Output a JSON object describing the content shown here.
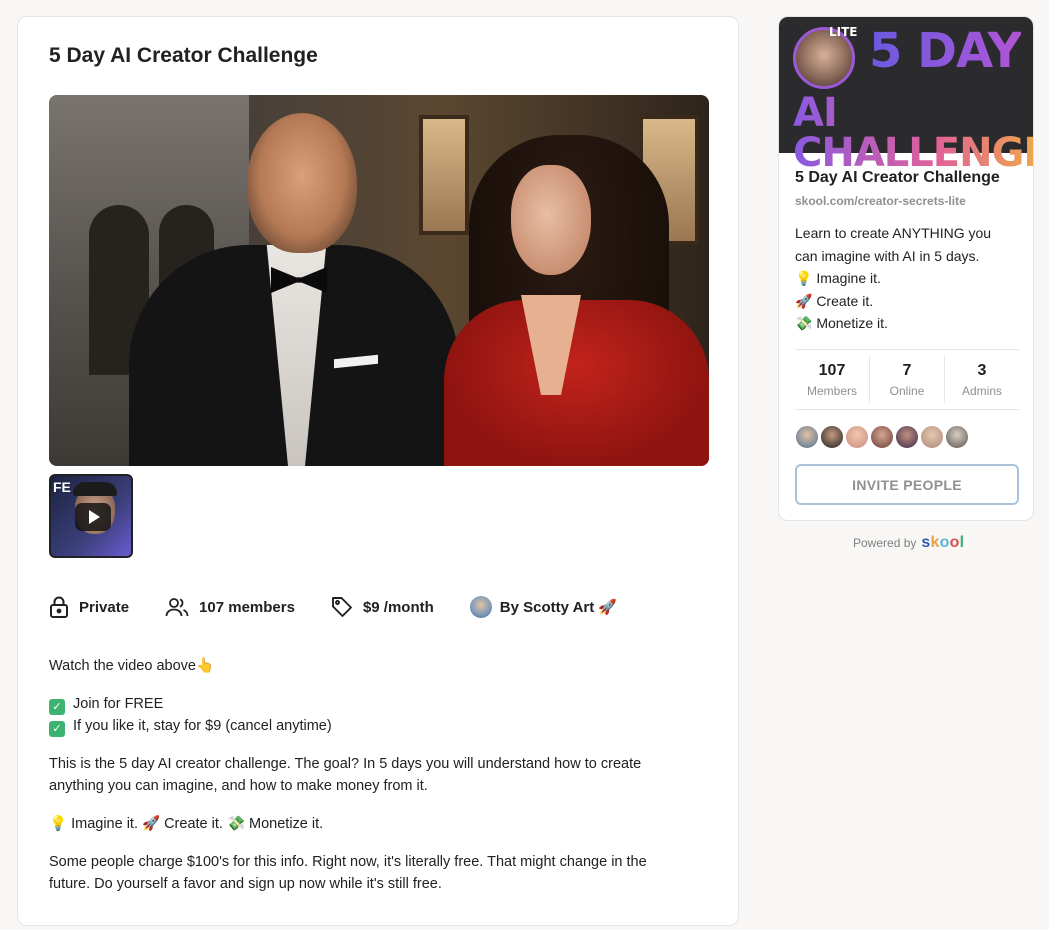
{
  "main": {
    "title": "5 Day AI Creator Challenge",
    "thumbnail": {
      "text": "FE"
    },
    "meta": {
      "privacy": "Private",
      "members": "107 members",
      "price": "$9 /month",
      "owner": "By Scotty Art 🚀"
    },
    "description": {
      "line1": "Watch the video above👆",
      "check1": "Join for FREE",
      "check2": "If you like it, stay for $9 (cancel anytime)",
      "para1": "This is the 5 day AI creator challenge. The goal? In 5 days you will understand how to create anything you can imagine, and how to make money from it.",
      "para2": "💡 Imagine it. 🚀 Create it. 💸 Monetize it.",
      "para3": "Some people charge $100's for this info. Right now, it's literally free. That might change in the future. Do yourself a favor and sign up now while it's still free."
    }
  },
  "sidebar": {
    "banner": {
      "badge": "LITE",
      "line1": "5 DAY",
      "line2": "AI CHALLENGE"
    },
    "title": "5 Day AI Creator Challenge",
    "url": "skool.com/creator-secrets-lite",
    "desc": {
      "line1": "Learn to create ANYTHING you can imagine with AI in 5 days.",
      "line2": "💡 Imagine it.",
      "line3": "🚀 Create it.",
      "line4": "💸 Monetize it."
    },
    "stats": [
      {
        "value": "107",
        "label": "Members"
      },
      {
        "value": "7",
        "label": "Online"
      },
      {
        "value": "3",
        "label": "Admins"
      }
    ],
    "invite_label": "INVITE PEOPLE"
  },
  "footer": {
    "powered_by": "Powered by",
    "brand": "skool"
  },
  "colors": {
    "accent_border": "#a9c3dd",
    "check_green": "#3cb371",
    "muted": "#909090"
  }
}
